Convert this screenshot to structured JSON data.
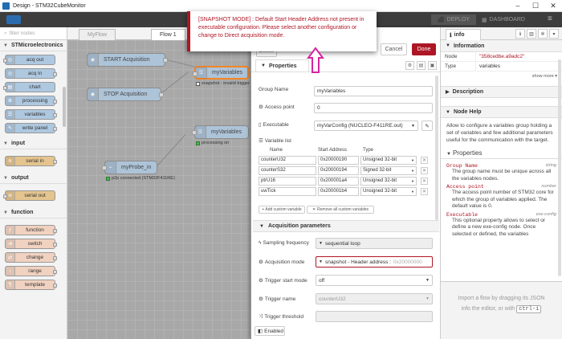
{
  "window": {
    "title": "Design - STM32CubeMonitor",
    "controls": [
      "–",
      "☐",
      "✕"
    ]
  },
  "header": {
    "deploy_label": "DEPLOY",
    "dashboard_label": "DASHBOARD"
  },
  "palette": {
    "filter_placeholder": "filter nodes",
    "categories": [
      {
        "name": "STMicroelectronics",
        "nodes": [
          "acq out",
          "acq in",
          "chart",
          "processing",
          "variables",
          "write panel"
        ]
      },
      {
        "name": "input",
        "nodes": [
          "serial in"
        ]
      },
      {
        "name": "output",
        "nodes": [
          "serial out"
        ]
      },
      {
        "name": "function",
        "nodes": [
          "function",
          "switch",
          "change",
          "range",
          "template"
        ]
      }
    ]
  },
  "workspace": {
    "tabs": [
      "MyFlow",
      "Flow 1"
    ],
    "nodes": {
      "start": "START Acquisition",
      "stop": "STOP Acquisition",
      "myvariables1": "myVariables",
      "myvariables1_status": "snapshot - invalid trigger",
      "myvariables2": "myVariables",
      "myvariables2_status": "processing on",
      "myprobe": "myProbe_in",
      "myprobe_status": "p2p connected (STM32F411RE)"
    }
  },
  "notification": {
    "text": "[SNAPSHOT MODE] : Default Start Header Address not present in executable configuration. Please select another configuration or change to Direct acquisition mode."
  },
  "editor": {
    "delete_label": "Delete",
    "cancel_label": "Cancel",
    "done_label": "Done",
    "properties_tab": "Properties",
    "group_name_label": "Group Name",
    "group_name_value": "myVariables",
    "access_point_label": "Access point",
    "access_point_value": "0",
    "executable_label": "Executable",
    "executable_value": "myVarConfig (NUCLEO-F411RE.out)",
    "variable_list_label": "Variable list",
    "columns": [
      "Name",
      "Start Address",
      "Type"
    ],
    "variables": [
      {
        "name": "counterU32",
        "address": "0x20000190",
        "type": "Unsigned 32-bit"
      },
      {
        "name": "counterS32",
        "address": "0x20000194",
        "type": "Signed 32-bit"
      },
      {
        "name": "ptrU16",
        "address": "0x200001a4",
        "type": "Unsigned 32-bit"
      },
      {
        "name": "uwTick",
        "address": "0x200001b4",
        "type": "Unsigned 32-bit"
      }
    ],
    "add_variable_label": "+ Add custom variable",
    "remove_all_label": "Remove all custom variables",
    "acq_section": "Acquisition parameters",
    "sampling_label": "Sampling frequency",
    "sampling_value": "sequential loop",
    "acq_mode_label": "Acquisition mode",
    "acq_mode_value": "snapshot - Header address :",
    "acq_mode_addr": "0x20000000",
    "trigger_start_label": "Trigger start mode",
    "trigger_start_value": "off",
    "trigger_name_label": "Trigger name",
    "trigger_name_value": "counterU32",
    "trigger_threshold_label": "Trigger threshold",
    "enabled_label": "Enabled"
  },
  "sidebar": {
    "tab_label": "info",
    "information_title": "Information",
    "node_key": "Node",
    "node_value": "\"358cedbe.a9adc2\"",
    "type_key": "Type",
    "type_value": "variables",
    "show_more": "show more",
    "description_title": "Description",
    "node_help_title": "Node Help",
    "help_text": "Allow to configure a variables group holding a set of variables and few additional parameters useful for the communication with the target.",
    "properties_title": "Properties",
    "props": [
      {
        "name": "Group Name",
        "type": "string",
        "desc": "The group name must be unique across all the variables nodes."
      },
      {
        "name": "Access point",
        "type": "number",
        "desc": "The access point number of STM32 core for which the group of variables applied. The default value is 0."
      },
      {
        "name": "Executable",
        "type": "exe-config",
        "desc": "This optional property allows to select or define a new exe-config node. Once selected or defined, the variables"
      }
    ],
    "footer_line1": "Import a flow by dragging its JSON",
    "footer_line2": "info the editor, or with",
    "footer_kbd": "ctrl-i"
  }
}
